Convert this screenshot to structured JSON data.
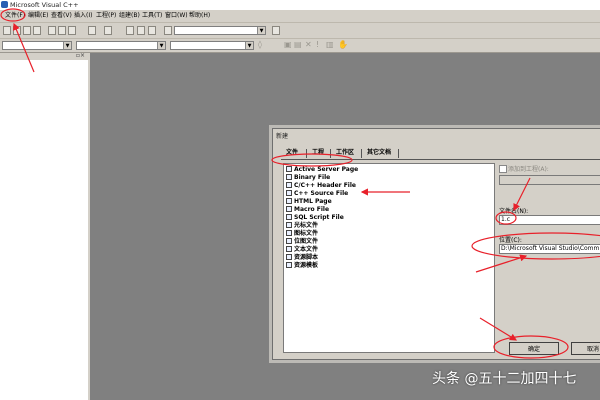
{
  "app": {
    "title": "Microsoft Visual C++"
  },
  "menu": [
    {
      "label": "文件(F)"
    },
    {
      "label": "编辑(E)"
    },
    {
      "label": "查看(V)"
    },
    {
      "label": "插入(I)"
    },
    {
      "label": "工程(P)"
    },
    {
      "label": "组建(B)"
    },
    {
      "label": "工具(T)"
    },
    {
      "label": "窗口(W)"
    },
    {
      "label": "帮助(H)"
    }
  ],
  "dialog": {
    "title": "新建",
    "tabs": [
      {
        "label": "文件"
      },
      {
        "label": "工程"
      },
      {
        "label": "工作区"
      },
      {
        "label": "其它文档"
      }
    ],
    "file_types": [
      {
        "label": "Active Server Page"
      },
      {
        "label": "Binary File"
      },
      {
        "label": "C/C++ Header File"
      },
      {
        "label": "C++ Source File"
      },
      {
        "label": "HTML Page"
      },
      {
        "label": "Macro File"
      },
      {
        "label": "SQL Script File"
      },
      {
        "label": "光标文件"
      },
      {
        "label": "图标文件"
      },
      {
        "label": "位图文件"
      },
      {
        "label": "文本文件"
      },
      {
        "label": "资源脚本"
      },
      {
        "label": "资源模板"
      }
    ],
    "selected_index": 3,
    "add_to_project_label": "添加到工程(A):",
    "filename_label": "文件名(N):",
    "filename_value": "1.c",
    "location_label": "位置(C):",
    "location_value": "D:\\Microsoft Visual Studio\\Comm",
    "ok_label": "确定",
    "cancel_label": "取消"
  },
  "watermark": "头条 @五十二加四十七",
  "colors": {
    "annotation": "#e8202a",
    "workspace": "#808080",
    "chrome": "#d4d0c8"
  }
}
